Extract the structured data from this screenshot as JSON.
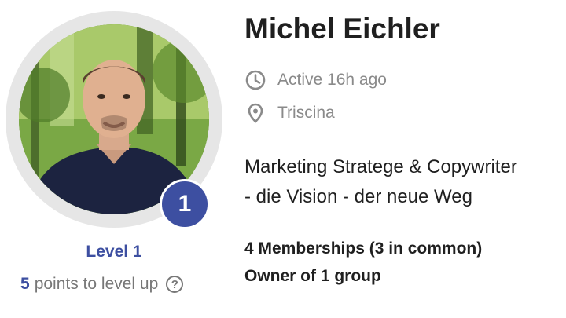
{
  "profile": {
    "name": "Michel Eichler",
    "level_number": "1",
    "level_label": "Level 1",
    "points_number": "5",
    "points_text": "points to level up",
    "help_glyph": "?",
    "active_text": "Active 16h ago",
    "location": "Triscina",
    "bio_line1": "Marketing Stratege & Copywriter",
    "bio_line2": "- die Vision - der neue Weg",
    "memberships": "4 Memberships (3 in common)",
    "ownership": "Owner of 1 group"
  },
  "icons": {
    "activity": "clock-icon",
    "location": "location-pin-icon",
    "help": "help-circle-icon"
  },
  "colors": {
    "accent": "#3d4fa1",
    "muted_text": "#8a8a8a",
    "ring": "#e6e6e6"
  }
}
